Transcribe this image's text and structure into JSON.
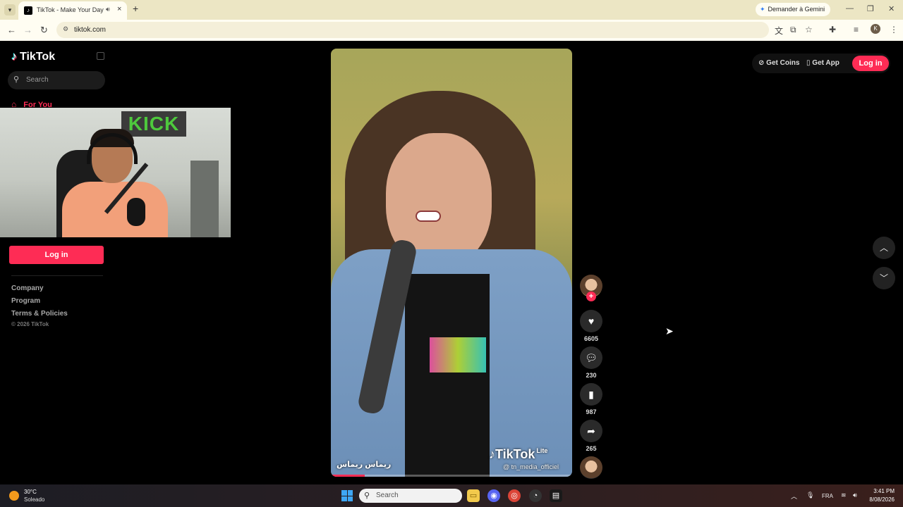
{
  "browser": {
    "tab_title": "TikTok - Make Your Day",
    "new_tab_symbol": "+",
    "gemini_button": "Demander à Gemini",
    "url": "tiktok.com"
  },
  "sidebar": {
    "logo_text": "TikTok",
    "search_placeholder": "Search",
    "nav_for_you": "For You",
    "webcam_sign": "KICK",
    "login_button": "Log in",
    "footer_links": [
      "Company",
      "Program",
      "Terms & Policies"
    ],
    "copyright": "© 2026 TikTok"
  },
  "video": {
    "author_name": "ريماس ريماس",
    "watermark": "TikTok",
    "watermark_badge": "Lite",
    "handle": "@ tn_media_officiel",
    "progress": 0.14
  },
  "actions": {
    "likes": "6605",
    "comments": "230",
    "saves": "987",
    "shares": "265"
  },
  "top_bar": {
    "get_coins": "Get Coins",
    "get_app": "Get App",
    "login": "Log in"
  },
  "taskbar": {
    "temperature": "30°C",
    "weather": "Soleado",
    "search_placeholder": "Search",
    "language": "FRA",
    "time": "3:41 PM",
    "date": "8/08/2026"
  },
  "colors": {
    "accent": "#fe2c55",
    "background": "#000000"
  }
}
